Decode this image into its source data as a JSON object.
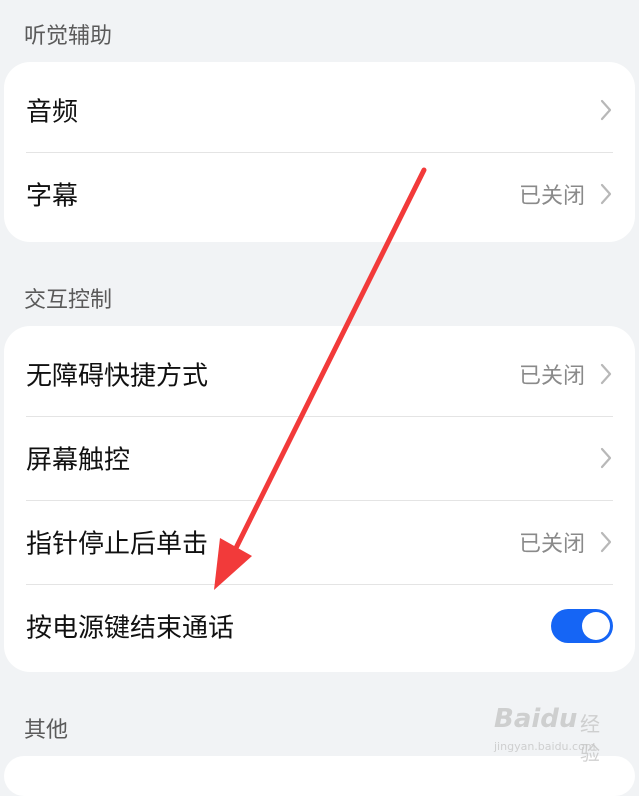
{
  "sections": {
    "hearing": {
      "title": "听觉辅助",
      "items": [
        {
          "label": "音频",
          "value": ""
        },
        {
          "label": "字幕",
          "value": "已关闭"
        }
      ]
    },
    "interaction": {
      "title": "交互控制",
      "items": [
        {
          "label": "无障碍快捷方式",
          "value": "已关闭"
        },
        {
          "label": "屏幕触控",
          "value": ""
        },
        {
          "label": "指针停止后单击",
          "value": "已关闭"
        },
        {
          "label": "按电源键结束通话",
          "toggle": "on"
        }
      ]
    },
    "other": {
      "title": "其他"
    }
  },
  "watermark": {
    "brand": "Baidu",
    "name": "经验",
    "url": "jingyan.baidu.com"
  },
  "colors": {
    "accent": "#1565f5",
    "annotation_arrow": "#f23a3a"
  }
}
